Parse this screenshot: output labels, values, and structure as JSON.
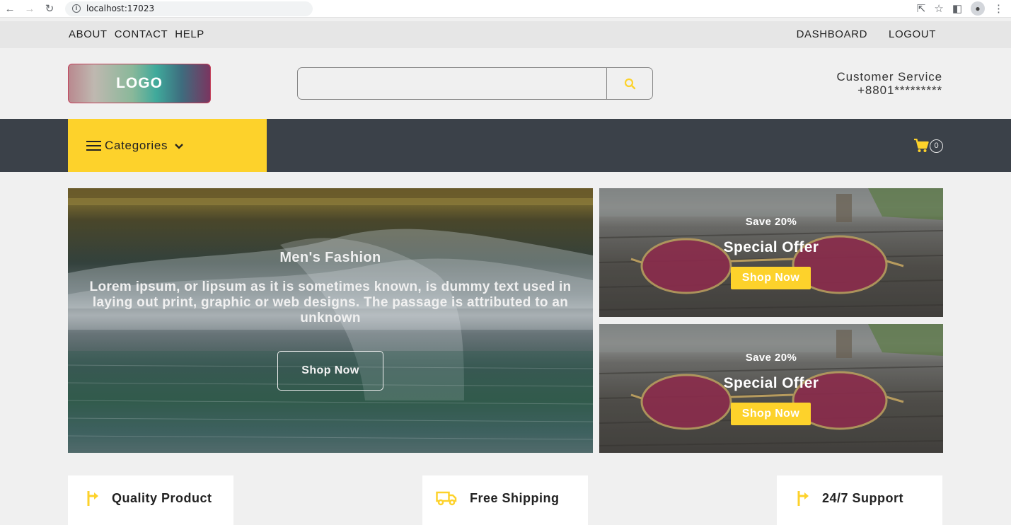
{
  "browser": {
    "url": "localhost:17023",
    "back_icon": "arrow-left-icon",
    "forward_icon": "arrow-right-icon",
    "reload_icon": "reload-icon"
  },
  "topbar": {
    "left_links": [
      "ABOUT",
      "CONTACT",
      "HELP"
    ],
    "right_links": [
      "DASHBOARD",
      "LOGOUT"
    ]
  },
  "header": {
    "logo": "LOGO",
    "search_placeholder": "",
    "customer_service_label": "Customer Service",
    "customer_service_phone": "+8801*********"
  },
  "nav": {
    "categories_label": "Categories",
    "cart_count": "0"
  },
  "hero": {
    "title": "Men's Fashion",
    "text": "Lorem ipsum, or lipsum as it is sometimes known, is dummy text used in laying out print, graphic or web designs. The passage is attributed to an unknown",
    "button": "Shop Now"
  },
  "offers": [
    {
      "save": "Save 20%",
      "title": "Special Offer",
      "button": "Shop Now"
    },
    {
      "save": "Save 20%",
      "title": "Special Offer",
      "button": "Shop Now"
    }
  ],
  "features": [
    {
      "label": "Quality Product",
      "icon": "turn-right-arrow-icon"
    },
    {
      "label": "Free Shipping",
      "icon": "truck-icon"
    },
    {
      "label": "24/7 Support",
      "icon": "turn-right-arrow-icon"
    }
  ],
  "colors": {
    "accent": "#fdd22b",
    "nav_dark": "#3b4149",
    "page_bg": "#f0f0f0",
    "topbar_bg": "#e6e6e6"
  }
}
